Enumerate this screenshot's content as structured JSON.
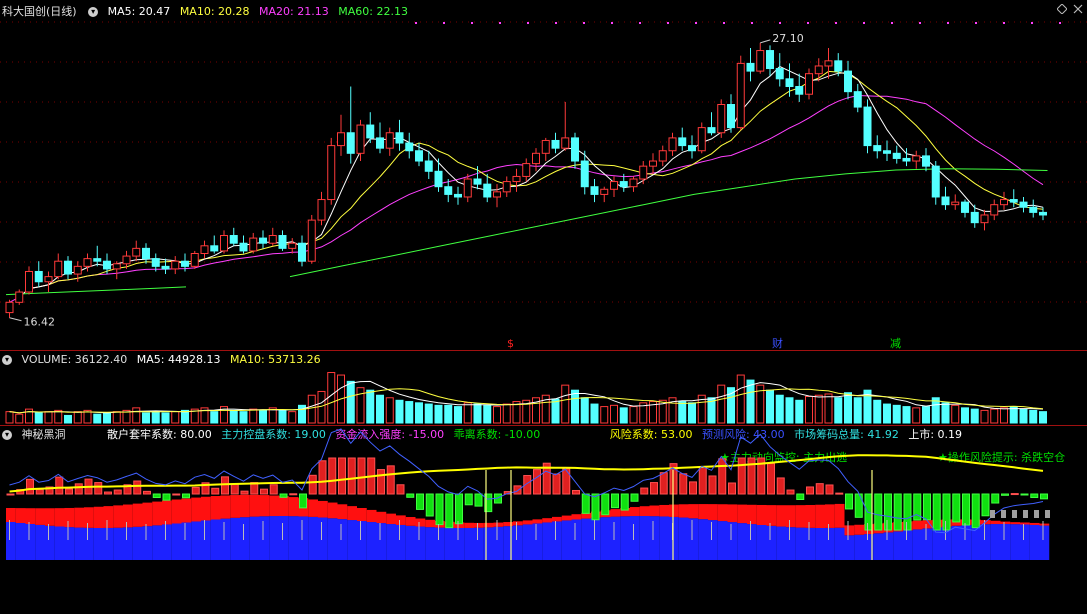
{
  "colors": {
    "up": "#ff3a3a",
    "down": "#54ffff",
    "ma5": "#ffffff",
    "ma10": "#ffff40",
    "ma20": "#ff40ff",
    "ma60": "#40ff40",
    "grid": "#7a0000",
    "white": "#ffffff",
    "yellow": "#ffff00",
    "green": "#00e000",
    "cyan": "#30e0e0",
    "blue": "#3a50ff",
    "red": "#ff2020",
    "magenta": "#ff40ff",
    "gray": "#b0b0b0"
  },
  "main": {
    "stock_name": "科大国创(日线)",
    "ma5": "MA5: 20.47",
    "ma10": "MA10: 20.28",
    "ma20": "MA20: 21.13",
    "ma60": "MA60: 22.13",
    "high_label": "27.10",
    "low_label": "16.42",
    "markers": [
      {
        "text": "$",
        "color": "red"
      },
      {
        "text": "财",
        "color": "blue"
      },
      {
        "text": "减",
        "color": "green"
      }
    ],
    "icons": [
      "collapse-icon",
      "diamond-icon",
      "close-icon"
    ]
  },
  "volume": {
    "title": "VOLUME: 36122.40",
    "ma5": "MA5: 44928.13",
    "ma10": "MA10: 53713.26"
  },
  "indicator": {
    "name": "神秘黑洞",
    "items": [
      {
        "text": "散户套牢系数: 80.00",
        "color": "white"
      },
      {
        "text": "主力控盘系数: 19.00",
        "color": "cyan"
      },
      {
        "text": "资金流入强度: -15.00",
        "color": "magenta"
      },
      {
        "text": "乖离系数: -10.00",
        "color": "green"
      }
    ],
    "items2": [
      {
        "text": "风险系数: 53.00",
        "color": "yellow"
      },
      {
        "text": "预测风险: 43.00",
        "color": "blue"
      },
      {
        "text": "市场筹码总量: 41.92",
        "color": "cyan"
      },
      {
        "text": "上市: 0.19",
        "color": "white"
      }
    ],
    "notice1": "★主力动向监控: 主力出逃",
    "notice2": "★操作风险提示: 杀跌空仓"
  },
  "chart_data": {
    "type": "candlestick",
    "candles": [
      [
        16.6,
        17.1,
        16.4,
        17.0
      ],
      [
        17.0,
        17.5,
        16.9,
        17.4
      ],
      [
        17.4,
        18.4,
        17.3,
        18.2
      ],
      [
        18.2,
        18.6,
        17.6,
        17.8
      ],
      [
        17.8,
        18.2,
        17.4,
        18.0
      ],
      [
        18.0,
        18.9,
        17.9,
        18.6
      ],
      [
        18.6,
        18.8,
        17.9,
        18.1
      ],
      [
        18.1,
        18.6,
        17.8,
        18.4
      ],
      [
        18.4,
        18.9,
        18.2,
        18.7
      ],
      [
        18.7,
        19.2,
        18.4,
        18.6
      ],
      [
        18.6,
        18.9,
        18.1,
        18.3
      ],
      [
        18.3,
        18.6,
        17.9,
        18.5
      ],
      [
        18.5,
        19.0,
        18.3,
        18.8
      ],
      [
        18.8,
        19.4,
        18.6,
        19.1
      ],
      [
        19.1,
        19.3,
        18.5,
        18.7
      ],
      [
        18.7,
        18.9,
        18.2,
        18.4
      ],
      [
        18.4,
        18.7,
        18.1,
        18.3
      ],
      [
        18.3,
        18.8,
        18.1,
        18.6
      ],
      [
        18.6,
        18.9,
        18.2,
        18.4
      ],
      [
        18.4,
        19.0,
        18.3,
        18.9
      ],
      [
        18.9,
        19.4,
        18.7,
        19.2
      ],
      [
        19.2,
        19.6,
        18.9,
        19.0
      ],
      [
        19.0,
        19.8,
        18.9,
        19.6
      ],
      [
        19.6,
        19.9,
        19.2,
        19.3
      ],
      [
        19.3,
        19.6,
        18.9,
        19.0
      ],
      [
        19.0,
        19.7,
        18.9,
        19.5
      ],
      [
        19.5,
        19.8,
        19.1,
        19.3
      ],
      [
        19.3,
        19.9,
        19.2,
        19.6
      ],
      [
        19.6,
        19.8,
        19.0,
        19.1
      ],
      [
        19.1,
        19.5,
        18.9,
        19.3
      ],
      [
        19.3,
        19.6,
        18.4,
        18.6
      ],
      [
        18.6,
        20.4,
        18.5,
        20.2
      ],
      [
        20.2,
        21.3,
        20.0,
        21.0
      ],
      [
        21.0,
        23.4,
        20.8,
        23.1
      ],
      [
        23.1,
        24.3,
        22.7,
        23.6
      ],
      [
        23.6,
        25.4,
        22.4,
        22.8
      ],
      [
        22.8,
        24.1,
        22.5,
        23.9
      ],
      [
        23.9,
        24.4,
        23.2,
        23.4
      ],
      [
        23.4,
        24.0,
        22.8,
        23.0
      ],
      [
        23.0,
        23.8,
        22.7,
        23.6
      ],
      [
        23.6,
        24.1,
        22.9,
        23.2
      ],
      [
        23.2,
        23.6,
        22.6,
        22.9
      ],
      [
        22.9,
        23.2,
        22.3,
        22.5
      ],
      [
        22.5,
        22.9,
        21.8,
        22.1
      ],
      [
        22.1,
        22.6,
        21.3,
        21.5
      ],
      [
        21.5,
        21.8,
        20.9,
        21.2
      ],
      [
        21.2,
        21.5,
        20.8,
        21.1
      ],
      [
        21.1,
        22.0,
        20.9,
        21.8
      ],
      [
        21.8,
        22.3,
        21.4,
        21.6
      ],
      [
        21.6,
        22.0,
        20.9,
        21.1
      ],
      [
        21.1,
        21.6,
        20.7,
        21.3
      ],
      [
        21.3,
        21.9,
        21.1,
        21.7
      ],
      [
        21.7,
        22.2,
        21.3,
        21.9
      ],
      [
        21.9,
        22.6,
        21.7,
        22.4
      ],
      [
        22.4,
        23.0,
        22.1,
        22.8
      ],
      [
        22.8,
        23.4,
        22.5,
        23.3
      ],
      [
        23.3,
        23.6,
        22.8,
        23.0
      ],
      [
        23.0,
        24.8,
        22.9,
        23.4
      ],
      [
        23.4,
        23.6,
        22.2,
        22.5
      ],
      [
        22.5,
        22.9,
        21.2,
        21.5
      ],
      [
        21.5,
        21.8,
        20.9,
        21.2
      ],
      [
        21.2,
        21.5,
        20.9,
        21.4
      ],
      [
        21.4,
        21.9,
        21.1,
        21.7
      ],
      [
        21.7,
        22.0,
        21.3,
        21.5
      ],
      [
        21.5,
        21.9,
        21.3,
        21.8
      ],
      [
        21.8,
        22.5,
        21.6,
        22.3
      ],
      [
        22.3,
        22.8,
        22.0,
        22.5
      ],
      [
        22.5,
        23.1,
        22.3,
        22.9
      ],
      [
        22.9,
        23.6,
        22.7,
        23.4
      ],
      [
        23.4,
        23.8,
        22.9,
        23.1
      ],
      [
        23.1,
        23.5,
        22.6,
        22.9
      ],
      [
        22.9,
        24.0,
        22.8,
        23.8
      ],
      [
        23.8,
        24.4,
        23.5,
        23.6
      ],
      [
        23.6,
        24.9,
        23.4,
        24.7
      ],
      [
        24.7,
        25.1,
        23.6,
        23.8
      ],
      [
        23.8,
        26.6,
        23.7,
        26.3
      ],
      [
        26.3,
        26.9,
        25.6,
        26.0
      ],
      [
        26.0,
        27.1,
        25.9,
        26.8
      ],
      [
        26.8,
        27.0,
        25.8,
        26.1
      ],
      [
        26.1,
        26.7,
        25.4,
        25.7
      ],
      [
        25.7,
        26.3,
        25.0,
        25.4
      ],
      [
        25.4,
        25.9,
        24.8,
        25.1
      ],
      [
        25.1,
        26.1,
        24.9,
        25.9
      ],
      [
        25.9,
        26.5,
        25.6,
        26.2
      ],
      [
        26.2,
        26.9,
        25.7,
        26.4
      ],
      [
        26.4,
        26.7,
        25.8,
        26.0
      ],
      [
        26.0,
        26.4,
        24.9,
        25.2
      ],
      [
        25.2,
        25.5,
        24.4,
        24.6
      ],
      [
        24.6,
        24.9,
        22.8,
        23.1
      ],
      [
        23.1,
        23.5,
        22.6,
        22.9
      ],
      [
        22.9,
        23.3,
        22.5,
        22.8
      ],
      [
        22.8,
        23.1,
        22.4,
        22.6
      ],
      [
        22.6,
        23.0,
        22.3,
        22.5
      ],
      [
        22.5,
        22.9,
        22.2,
        22.7
      ],
      [
        22.7,
        23.0,
        22.1,
        22.3
      ],
      [
        22.3,
        22.5,
        20.8,
        21.1
      ],
      [
        21.1,
        21.5,
        20.6,
        20.8
      ],
      [
        20.8,
        21.2,
        20.6,
        20.9
      ],
      [
        20.9,
        21.0,
        20.3,
        20.5
      ],
      [
        20.5,
        20.8,
        19.9,
        20.1
      ],
      [
        20.1,
        20.6,
        19.8,
        20.4
      ],
      [
        20.4,
        21.0,
        20.2,
        20.8
      ],
      [
        20.8,
        21.3,
        20.6,
        21.0
      ],
      [
        21.0,
        21.4,
        20.7,
        20.9
      ],
      [
        20.9,
        21.1,
        20.5,
        20.7
      ],
      [
        20.7,
        21.0,
        20.3,
        20.5
      ],
      [
        20.5,
        20.7,
        20.2,
        20.4
      ]
    ],
    "ma60": [
      17.3,
      17.35,
      17.4,
      17.45,
      17.5,
      17.55,
      17.6
    ],
    "ma60_tail": [
      18.0,
      18.4,
      18.8,
      19.2,
      19.6,
      20.0,
      20.4,
      20.8,
      21.2,
      21.5,
      21.8,
      22.0,
      22.15,
      22.2,
      22.18,
      22.13
    ],
    "volume_ma5_label": "MA5",
    "volume_ma10_label": "MA10",
    "volumes": [
      9,
      7,
      11,
      8,
      9,
      10,
      6,
      9,
      10,
      7,
      8,
      9,
      10,
      12,
      8,
      9,
      8,
      9,
      10,
      11,
      12,
      9,
      13,
      10,
      9,
      11,
      10,
      12,
      10,
      9,
      14,
      22,
      25,
      40,
      38,
      33,
      28,
      26,
      22,
      20,
      18,
      17,
      16,
      15,
      14,
      14,
      13,
      16,
      15,
      14,
      13,
      15,
      17,
      18,
      20,
      22,
      19,
      30,
      26,
      20,
      15,
      13,
      14,
      12,
      13,
      16,
      17,
      18,
      20,
      17,
      16,
      22,
      20,
      30,
      28,
      38,
      34,
      30,
      26,
      22,
      20,
      18,
      21,
      22,
      23,
      20,
      24,
      20,
      26,
      18,
      15,
      14,
      13,
      12,
      13,
      20,
      16,
      14,
      12,
      11,
      10,
      11,
      12,
      13,
      11,
      10,
      9
    ]
  }
}
